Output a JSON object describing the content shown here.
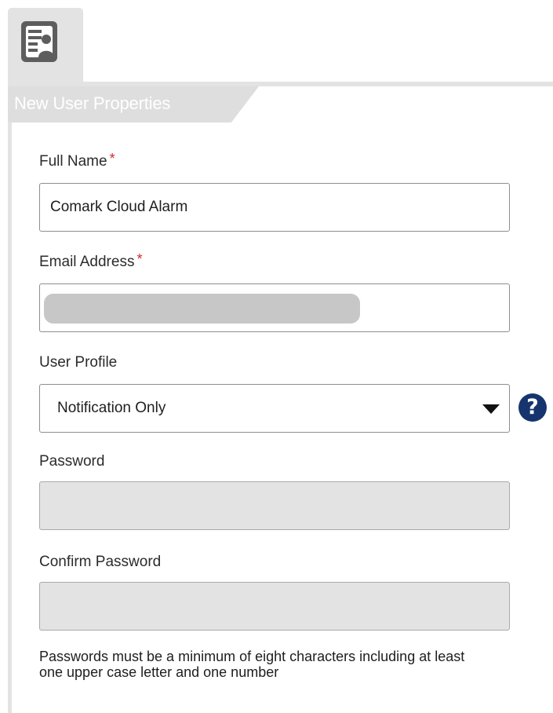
{
  "icon": "user-card-icon",
  "section": {
    "title": "New User Properties"
  },
  "form": {
    "full_name": {
      "label": "Full Name",
      "required": "*",
      "value": "Comark Cloud Alarm"
    },
    "email": {
      "label": "Email Address",
      "required": "*"
    },
    "user_profile": {
      "label": "User Profile",
      "selected": "Notification Only",
      "help": "?"
    },
    "password": {
      "label": "Password"
    },
    "confirm_password": {
      "label": "Confirm Password"
    },
    "hint": "Passwords must be a minimum of eight characters including at least one upper case letter and one number"
  },
  "colors": {
    "help_icon": "#16356e",
    "required": "#d6282b",
    "disabled_field": "#e3e3e3",
    "panel_chrome": "#e3e3e3"
  }
}
